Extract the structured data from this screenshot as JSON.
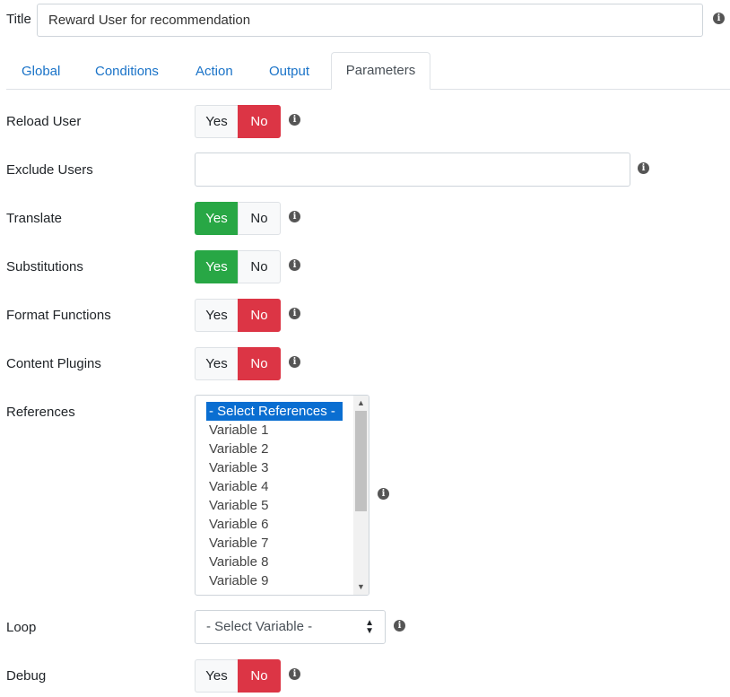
{
  "title": {
    "label": "Title",
    "value": "Reward User for recommendation"
  },
  "tabs": [
    {
      "label": "Global"
    },
    {
      "label": "Conditions"
    },
    {
      "label": "Action"
    },
    {
      "label": "Output"
    },
    {
      "label": "Parameters",
      "active": true
    }
  ],
  "fields": {
    "reload_user": {
      "label": "Reload User",
      "yes": "Yes",
      "no": "No",
      "value": "No"
    },
    "exclude_users": {
      "label": "Exclude Users",
      "value": ""
    },
    "translate": {
      "label": "Translate",
      "yes": "Yes",
      "no": "No",
      "value": "Yes"
    },
    "substitutions": {
      "label": "Substitutions",
      "yes": "Yes",
      "no": "No",
      "value": "Yes"
    },
    "format_functions": {
      "label": "Format Functions",
      "yes": "Yes",
      "no": "No",
      "value": "No"
    },
    "content_plugins": {
      "label": "Content Plugins",
      "yes": "Yes",
      "no": "No",
      "value": "No"
    },
    "references": {
      "label": "References",
      "options": [
        "- Select References -",
        "Variable 1",
        "Variable 2",
        "Variable 3",
        "Variable 4",
        "Variable 5",
        "Variable 6",
        "Variable 7",
        "Variable 8",
        "Variable 9"
      ],
      "selected": "- Select References -"
    },
    "loop": {
      "label": "Loop",
      "value": "- Select Variable -"
    },
    "debug": {
      "label": "Debug",
      "yes": "Yes",
      "no": "No",
      "value": "No"
    }
  },
  "icons": {
    "info": "info-icon",
    "caret": "sort-caret-icon",
    "scroll_up": "chevron-up-icon",
    "scroll_down": "chevron-down-icon"
  },
  "colors": {
    "yes_active": "#28a745",
    "no_active": "#dc3545",
    "link": "#1a73c8",
    "list_selected": "#0a6ed1"
  }
}
